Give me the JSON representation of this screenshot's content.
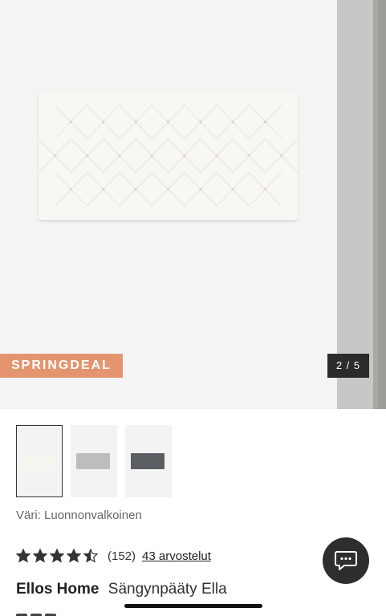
{
  "gallery": {
    "badge": "SPRINGDEAL",
    "counter": "2 / 5",
    "headboard_color": "#f8f7f3"
  },
  "thumbnails": [
    {
      "color": "#f6f5f0",
      "selected": true
    },
    {
      "color": "#bdbdbd",
      "selected": false
    },
    {
      "color": "#5a5d62",
      "selected": false
    }
  ],
  "color_label": "Väri: Luonnonvalkoinen",
  "rating": {
    "value": 4.5,
    "max": 5,
    "count": "(152)",
    "reviews_link": "43 arvostelut"
  },
  "product": {
    "brand": "Ellos Home",
    "name": "Sängynpääty Ella"
  },
  "icons": {
    "chat": "chat-icon",
    "star": "star-icon"
  },
  "colors": {
    "badge_bg": "#e4956f",
    "counter_bg": "#2b2b2b",
    "chat_bg": "#2e2e2e"
  }
}
